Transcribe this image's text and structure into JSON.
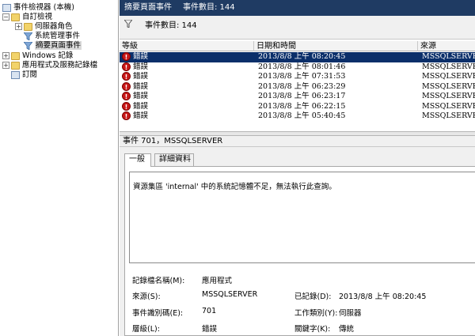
{
  "tree": {
    "items": [
      {
        "label": "事件檢視器 (本機)",
        "expander": "",
        "icon": "event-viewer-icon"
      },
      {
        "label": "自訂檢視",
        "expander": "−",
        "icon": "folder-icon"
      },
      {
        "label": "伺服器角色",
        "expander": "+",
        "icon": "folder-icon"
      },
      {
        "label": "系統管理事件",
        "expander": "",
        "icon": "filter-icon"
      },
      {
        "label": "摘要頁面事件",
        "expander": "",
        "icon": "filter-icon"
      },
      {
        "label": "Windows 記錄",
        "expander": "+",
        "icon": "folder-icon"
      },
      {
        "label": "應用程式及服務記錄檔",
        "expander": "+",
        "icon": "folder-icon"
      },
      {
        "label": "訂閱",
        "expander": "",
        "icon": "subscription-icon"
      }
    ]
  },
  "header": {
    "title": "摘要頁面事件",
    "count": "事件數目: 144"
  },
  "filter": {
    "text": "事件數目: 144"
  },
  "grid": {
    "columns": [
      "等級",
      "日期和時間",
      "來源"
    ],
    "rows": [
      {
        "level": "錯誤",
        "datetime": "2013/8/8 上午 08:20:45",
        "source": "MSSQLSERVER"
      },
      {
        "level": "錯誤",
        "datetime": "2013/8/8 上午 08:01:46",
        "source": "MSSQLSERVER"
      },
      {
        "level": "錯誤",
        "datetime": "2013/8/8 上午 07:31:53",
        "source": "MSSQLSERVER"
      },
      {
        "level": "錯誤",
        "datetime": "2013/8/8 上午 06:23:29",
        "source": "MSSQLSERVER"
      },
      {
        "level": "錯誤",
        "datetime": "2013/8/8 上午 06:23:17",
        "source": "MSSQLSERVER"
      },
      {
        "level": "錯誤",
        "datetime": "2013/8/8 上午 06:22:15",
        "source": "MSSQLSERVER"
      },
      {
        "level": "錯誤",
        "datetime": "2013/8/8 上午 05:40:45",
        "source": "MSSQLSERVER"
      }
    ]
  },
  "detail": {
    "heading": "事件 701，MSSQLSERVER",
    "tabs": [
      "一般",
      "詳細資料"
    ],
    "message": "資源集區 'internal' 中的系統記憶體不足，無法執行此查詢。",
    "props": {
      "log_name_label": "記錄檔名稱(M):",
      "log_name_value": "應用程式",
      "source_label": "來源(S):",
      "source_value": "MSSQLSERVER",
      "logged_label": "已記錄(D):",
      "logged_value": "2013/8/8 上午 08:20:45",
      "event_id_label": "事件識別碼(E):",
      "event_id_value": "701",
      "task_label": "工作類別(Y):",
      "task_value": "伺服器",
      "level_label": "層級(L):",
      "level_value": "錯誤",
      "keywords_label": "關鍵字(K):",
      "keywords_value": "傳統"
    }
  }
}
